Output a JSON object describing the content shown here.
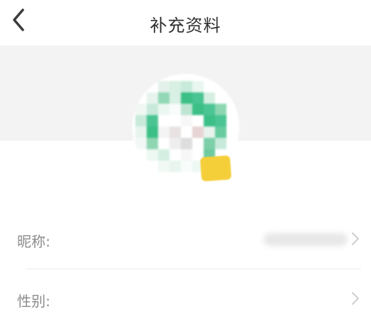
{
  "header": {
    "title": "补充资料",
    "back_icon": "chevron-left-icon"
  },
  "profile": {
    "avatar": "pixelated-avatar",
    "badge_color": "#f5cf3a"
  },
  "form": {
    "nickname_label": "昵称:",
    "gender_label": "性别:",
    "chevron_icon": "chevron-right-icon"
  },
  "colors": {
    "background": "#f3f3f3",
    "title": "#303030",
    "label": "#8c8c8c",
    "avatar_green": "#3cbf87",
    "badge_yellow": "#f5cf3a"
  }
}
